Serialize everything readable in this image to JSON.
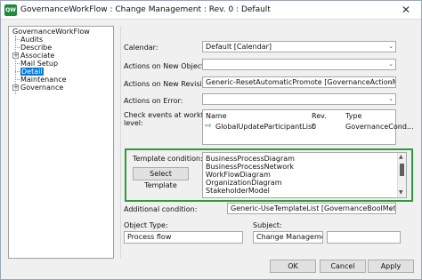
{
  "window": {
    "title": "GovernanceWorkFlow : Change Management : Rev. 0  : Default",
    "app_icon": "QW"
  },
  "tree": {
    "items": [
      {
        "label": "GovernanceWorkFlow",
        "expander": ""
      },
      {
        "label": "Audits",
        "expander": ""
      },
      {
        "label": "Describe",
        "expander": ""
      },
      {
        "label": "Associate",
        "expander": "+"
      },
      {
        "label": "Mail Setup",
        "expander": ""
      },
      {
        "label": "Detail",
        "expander": ""
      },
      {
        "label": "Maintenance",
        "expander": ""
      },
      {
        "label": "Governance",
        "expander": "+"
      }
    ],
    "selected": "Detail"
  },
  "form": {
    "calendar_label": "Calendar:",
    "calendar_value": "Default [Calendar]",
    "new_object_label": "Actions on New Object:",
    "new_object_value": "",
    "new_revision_label": "Actions on New Revision:",
    "new_revision_value": "Generic-ResetAutomaticPromote [GovernanceActionMethod]",
    "on_error_label": "Actions on Error:",
    "on_error_value": "",
    "check_events_label_1": "Check events at workflow",
    "check_events_label_2": "level:",
    "grid": {
      "columns": [
        "Name",
        "Rev.",
        "Type"
      ],
      "rows": [
        {
          "name": "GlobalUpdateParticipantList",
          "rev": "0",
          "type": "GovernanceCond..."
        }
      ]
    },
    "template_condition_label": "Template condition:",
    "select_template_button": "Select Template",
    "template_list": [
      "BusinessProcessDiagram",
      "BusinessProcessNetwork",
      "WorkFlowDiagram",
      "OrganizationDiagram",
      "StakeholderModel"
    ],
    "additional_condition_label": "Additional condition:",
    "additional_condition_value": "Generic-UseTemplateList [GovernanceBoolMethod]",
    "object_type_label": "Object Type:",
    "object_type_value": "Process flow",
    "subject_label": "Subject:",
    "subject_value": "Change Management -",
    "subject_value_2": ""
  },
  "buttons": {
    "ok": "OK",
    "cancel": "Cancel",
    "apply": "Apply"
  },
  "icons": {
    "dropdown": "chevron-down-icon",
    "close": "close-icon",
    "row_arrow": "arrow-right-icon"
  },
  "colors": {
    "selection": "#0078d7",
    "highlight_border": "#2e9a3a",
    "app_icon": "#1e8a3c"
  }
}
